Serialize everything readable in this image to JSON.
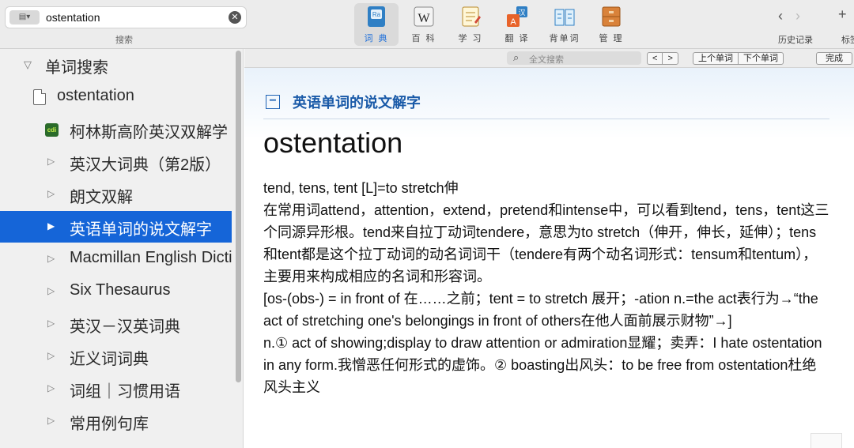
{
  "search": {
    "scope_label": "▤▾",
    "query": "ostentation",
    "caption": "搜索"
  },
  "toolbar": {
    "tools": [
      {
        "label": "词 典",
        "icon": "dictionary-icon"
      },
      {
        "label": "百 科",
        "icon": "wikipedia-icon"
      },
      {
        "label": "学 习",
        "icon": "study-icon"
      },
      {
        "label": "翻 译",
        "icon": "translate-icon"
      },
      {
        "label": "背单词",
        "icon": "flashcards-icon"
      },
      {
        "label": "管 理",
        "icon": "manage-icon"
      }
    ],
    "history_caption": "历史记录",
    "bookmark_caption": "标签",
    "back_symbol": "‹",
    "forward_symbol": "›",
    "add_symbol": "+"
  },
  "sidebar": {
    "header": "单词搜索",
    "word": "ostentation",
    "items": [
      "柯林斯高阶英汉双解学",
      "英汉大词典（第2版）",
      "朗文双解",
      "英语单词的说文解字",
      "Macmillan English Dicti",
      "Six Thesaurus",
      "英汉－汉英词典",
      "近义词词典",
      "词组｜习惯用语",
      "常用例句库"
    ],
    "selected_index": 3
  },
  "subbar": {
    "fulltext_placeholder": "全文搜索",
    "prev_arrow": "<",
    "next_arrow": ">",
    "prev_word": "上个单词",
    "next_word": "下个单词",
    "done": "完成"
  },
  "entry": {
    "dictionary_title": "英语单词的说文解字",
    "headword": "ostentation",
    "paragraphs": [
      "tend, tens, tent [L]=to stretch伸",
      "在常用词attend，attention，extend，pretend和intense中，可以看到tend，tens，tent这三个同源异形根。tend来自拉丁动词tendere，意思为to stretch（伸开，伸长，延伸）；tens和tent都是这个拉丁动词的动名词词干（tendere有两个动名词形式：tensum和tentum），主要用来构成相应的名词和形容词。",
      "[os-(obs-) = in front of 在……之前；tent = to stretch 展开；-ation n.=the act表行为→“the act of stretching one's belongings in front of others在他人面前展示财物”→]",
      "n.① act of showing;display to draw attention or admiration显耀；卖弄：I hate ostentation in any form.我憎恶任何形式的虚饰。② boasting出风头：to be free from ostentation杜绝风头主义"
    ]
  },
  "colors": {
    "accent": "#1565d8",
    "title_blue": "#1a5aa8"
  }
}
